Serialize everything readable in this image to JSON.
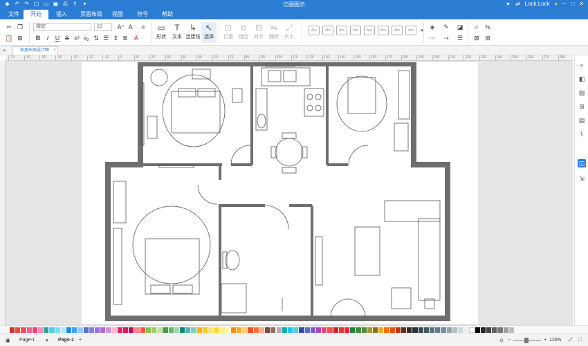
{
  "app": {
    "title": "亿图图示"
  },
  "titlebar": {
    "quick_icons": [
      "app-logo-icon",
      "undo-icon",
      "redo-icon",
      "new-file-icon",
      "open-folder-icon",
      "save-icon",
      "print-icon",
      "export-icon",
      "more-icon"
    ],
    "user_label": "Lock.Lock"
  },
  "menu": {
    "items": [
      {
        "label": "文件"
      },
      {
        "label": "开始"
      },
      {
        "label": "插入"
      },
      {
        "label": "页面布局"
      },
      {
        "label": "视图"
      },
      {
        "label": "符号"
      },
      {
        "label": "帮助"
      }
    ],
    "active_index": 1
  },
  "ribbon": {
    "font_name": "微软",
    "font_size": "10",
    "tools": [
      {
        "label": "形状"
      },
      {
        "label": "文本"
      },
      {
        "label": "连接线"
      },
      {
        "label": "选择"
      }
    ],
    "disabled_tools": [
      {
        "label": "位置"
      },
      {
        "label": "组合"
      },
      {
        "label": "对齐"
      },
      {
        "label": "翻转"
      },
      {
        "label": "大小"
      }
    ],
    "style_presets": [
      "Abc",
      "Abc",
      "Abc",
      "Abc",
      "Abc",
      "Abc",
      "Abc",
      "Abc"
    ]
  },
  "document": {
    "tab_label": "家居布局设计图"
  },
  "ruler": {
    "numbers": [
      "-70",
      "-60",
      "-50",
      "-40",
      "-30",
      "-20",
      "-10",
      "0",
      "10",
      "20",
      "30",
      "40",
      "50",
      "60",
      "70",
      "80",
      "90",
      "100",
      "110",
      "120",
      "130",
      "140",
      "150",
      "160",
      "170",
      "180",
      "190",
      "200",
      "210",
      "220",
      "230",
      "240",
      "250",
      "260",
      "270",
      "280"
    ]
  },
  "right_panel": {
    "icons": [
      "expand-panel-icon",
      "format-icon",
      "image-icon",
      "grid-layout-icon",
      "page-icon",
      "chart-icon",
      "theme-icon",
      "hyperlink-icon"
    ],
    "active_index": 6
  },
  "palette": {
    "colors": [
      "#c0392b",
      "#e74c3c",
      "#e8505b",
      "#f06292",
      "#ec407a",
      "#f48fb1",
      "#26a69a",
      "#4dd0e1",
      "#80deea",
      "#b2ebf2",
      "#1e88e5",
      "#42a5f5",
      "#90caf9",
      "#5c6bc0",
      "#7986cb",
      "#9575cd",
      "#ba68c8",
      "#ce93d8",
      "#f8bbd0",
      "#e91e63",
      "#d81b60",
      "#ad1457",
      "#ff8a80",
      "#ff5252",
      "#8bc34a",
      "#9ccc65",
      "#c5e1a5",
      "#43a047",
      "#66bb6a",
      "#a5d6a7",
      "#00897b",
      "#4db6ac",
      "#80cbc4",
      "#ffb300",
      "#ffca28",
      "#ffe082",
      "#fdd835",
      "#fff176",
      "#fff9c4",
      "#fb8c00",
      "#ffa726",
      "#ffcc80",
      "#f4511e",
      "#ff7043",
      "#ffab91",
      "#6d4c41",
      "#8d6e63",
      "#bcaaa4",
      "#00acc1",
      "#26c6da",
      "#4dd0e1",
      "#3949ab",
      "#5c6bc0",
      "#7e57c2",
      "#ab47bc",
      "#ec407a",
      "#ef5350",
      "#c62828",
      "#e53935",
      "#ff1744",
      "#2e7d32",
      "#388e3c",
      "#558b2f",
      "#9e9d24",
      "#827717",
      "#f9a825",
      "#ff6f00",
      "#e65100",
      "#bf360c",
      "#4e342e",
      "#3e2723",
      "#263238",
      "#37474f",
      "#455a64",
      "#546e7a",
      "#607d8b",
      "#78909c",
      "#90a4ae",
      "#b0bec5",
      "#cfd8dc",
      "#eceff1",
      "#ffffff",
      "#000000",
      "#212121",
      "#424242",
      "#616161",
      "#757575",
      "#9e9e9e",
      "#bdbdbd"
    ]
  },
  "status": {
    "page_selector": "Page-1",
    "page_tab": "Page-1",
    "zoom": "115%"
  }
}
